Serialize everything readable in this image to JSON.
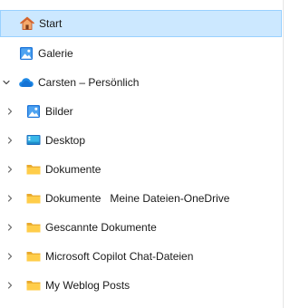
{
  "nav": {
    "quick_access": [
      {
        "label": "Start",
        "icon": "home-icon",
        "selected": true
      },
      {
        "label": "Galerie",
        "icon": "gallery-icon",
        "selected": false
      }
    ],
    "onedrive": {
      "label": "Carsten – Persönlich",
      "icon": "onedrive-cloud-icon",
      "expanded": true
    },
    "children": [
      {
        "label": "Bilder",
        "icon": "pictures-folder-icon"
      },
      {
        "label": "Desktop",
        "icon": "desktop-folder-icon"
      },
      {
        "label": "Dokumente",
        "icon": "folder-icon"
      },
      {
        "label": "Dokumente   Meine Dateien-OneDrive",
        "icon": "folder-icon"
      },
      {
        "label": "Gescannte Dokumente",
        "icon": "folder-icon"
      },
      {
        "label": "Microsoft Copilot Chat-Dateien",
        "icon": "folder-icon"
      },
      {
        "label": "My Weblog Posts",
        "icon": "folder-icon"
      }
    ]
  },
  "colors": {
    "selection_bg": "#cce8ff",
    "selection_border": "#99d1ff",
    "folder_yellow": "#ffcd4a",
    "onedrive_blue": "#1e88e5",
    "chevron": "#5f5f5f"
  }
}
